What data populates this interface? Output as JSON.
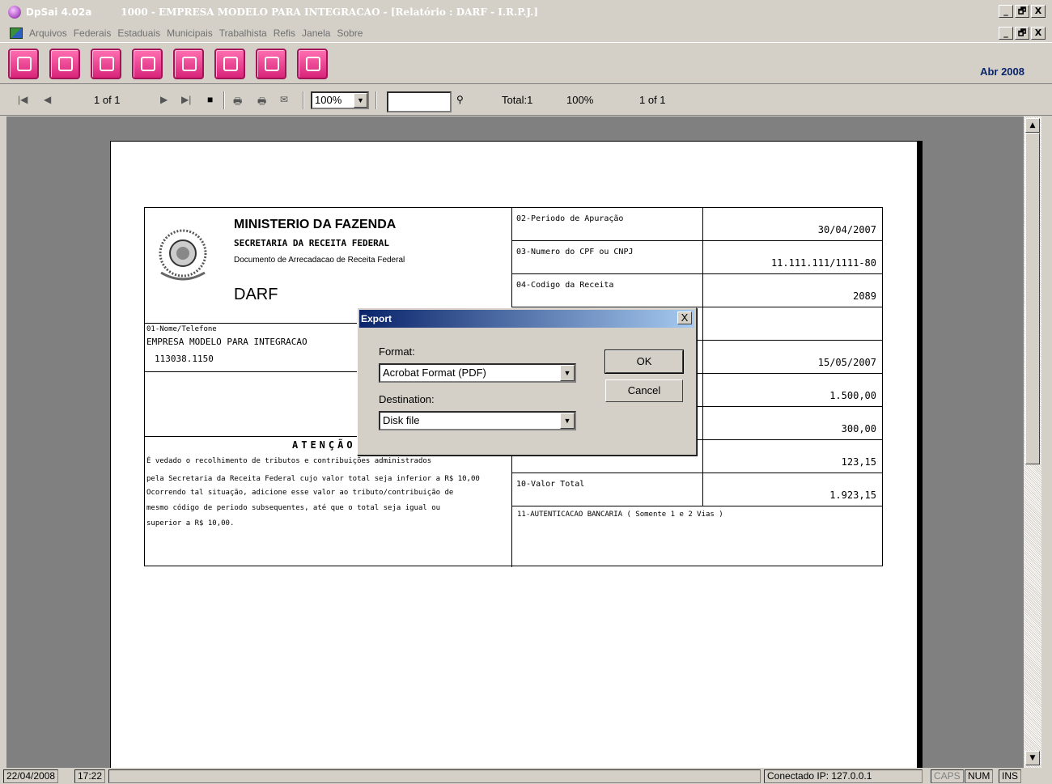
{
  "window": {
    "app_title": "DpSai 4.02a",
    "title": "1000 - EMPRESA MODELO PARA INTEGRACAO - [Relatório : DARF - I.R.P.J.]",
    "min": "_",
    "restore": "🗗",
    "close": "X"
  },
  "menu": [
    "Arquivos",
    "Federais",
    "Estaduais",
    "Municipais",
    "Trabalhista",
    "Refis",
    "Janela",
    "Sobre"
  ],
  "period": "Abr 2008",
  "report_toolbar": {
    "page_nav": "1 of 1",
    "zoom": "100%",
    "total": "Total:1",
    "zoom_status": "100%",
    "page_status": "1 of 1"
  },
  "darf": {
    "org": "MINISTERIO DA FAZENDA",
    "secretaria": "SECRETARIA DA RECEITA FEDERAL",
    "doc": "Documento de Arrecadacao de Receita Federal",
    "darf": "DARF",
    "nome_caption": "01-Nome/Telefone",
    "empresa": "EMPRESA MODELO PARA INTEGRACAO",
    "telefone": "113038.1150",
    "atencao": "ATENÇÃO",
    "aviso": [
      "É vedado o recolhimento de tributos e contribuições administrados",
      "pela Secretaria da Receita Federal cujo valor total seja inferior a R$ 10,00",
      "Ocorrendo tal situação, adicione esse valor ao tributo/contribuição de",
      "mesmo código de periodo subsequentes, até que o total seja igual ou",
      "superior a R$ 10,00."
    ],
    "fields": [
      {
        "caption": "02-Periodo de Apuração",
        "value": "30/04/2007"
      },
      {
        "caption": "03-Numero do CPF ou CNPJ",
        "value": "11.111.111/1111-80"
      },
      {
        "caption": "04-Codigo da Receita",
        "value": "2089"
      },
      {
        "caption": "",
        "value": ""
      },
      {
        "caption": "",
        "value": "15/05/2007"
      },
      {
        "caption": "",
        "value": "1.500,00"
      },
      {
        "caption": "",
        "value": "300,00"
      },
      {
        "caption": "",
        "value": "123,15"
      },
      {
        "caption": "10-Valor Total",
        "value": "1.923,15"
      }
    ],
    "autenticacao": "11-AUTENTICACAO BANCARIA ( Somente 1 e 2 Vias )"
  },
  "dialog": {
    "title": "Export",
    "close": "X",
    "format_label": "Format:",
    "format_value": "Acrobat Format (PDF)",
    "destination_label": "Destination:",
    "destination_value": "Disk file",
    "ok": "OK",
    "cancel": "Cancel"
  },
  "status": {
    "date": "22/04/2008",
    "time": "17:22",
    "connection": "Conectado IP: 127.0.0.1",
    "caps": "CAPS",
    "num": "NUM",
    "ins": "INS"
  }
}
